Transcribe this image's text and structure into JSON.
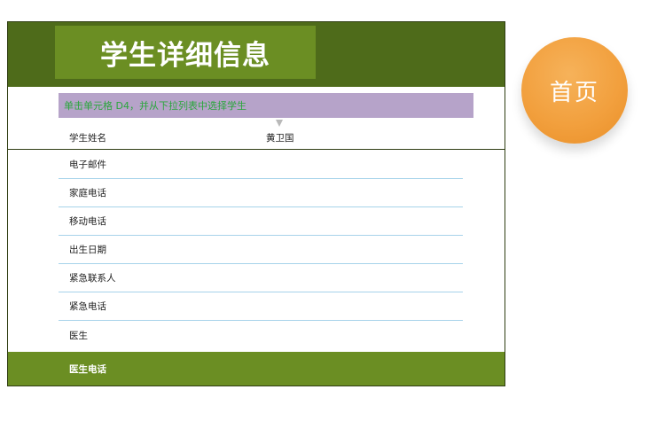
{
  "title": "学生详细信息",
  "instruction": "单击单元格 D4，并从下拉列表中选择学生",
  "name_row": {
    "label": "学生姓名",
    "value": "黄卫国"
  },
  "fields": [
    {
      "label": "电子邮件",
      "value": ""
    },
    {
      "label": "家庭电话",
      "value": ""
    },
    {
      "label": "移动电话",
      "value": ""
    },
    {
      "label": "出生日期",
      "value": ""
    },
    {
      "label": "紧急联系人",
      "value": ""
    },
    {
      "label": "紧急电话",
      "value": ""
    },
    {
      "label": "医生",
      "value": ""
    }
  ],
  "footer": {
    "label": "医生电话"
  },
  "home_button": {
    "label": "首页"
  },
  "colors": {
    "header_dark": "#4e6b1a",
    "header_green": "#6b8e23",
    "instruction_bg": "#b6a3c9",
    "instruction_text": "#2aa63c",
    "row_line": "#a7d3ea",
    "home_orange": "#f2a03e"
  },
  "icons": {
    "dropdown": "dropdown-triangle-icon"
  }
}
